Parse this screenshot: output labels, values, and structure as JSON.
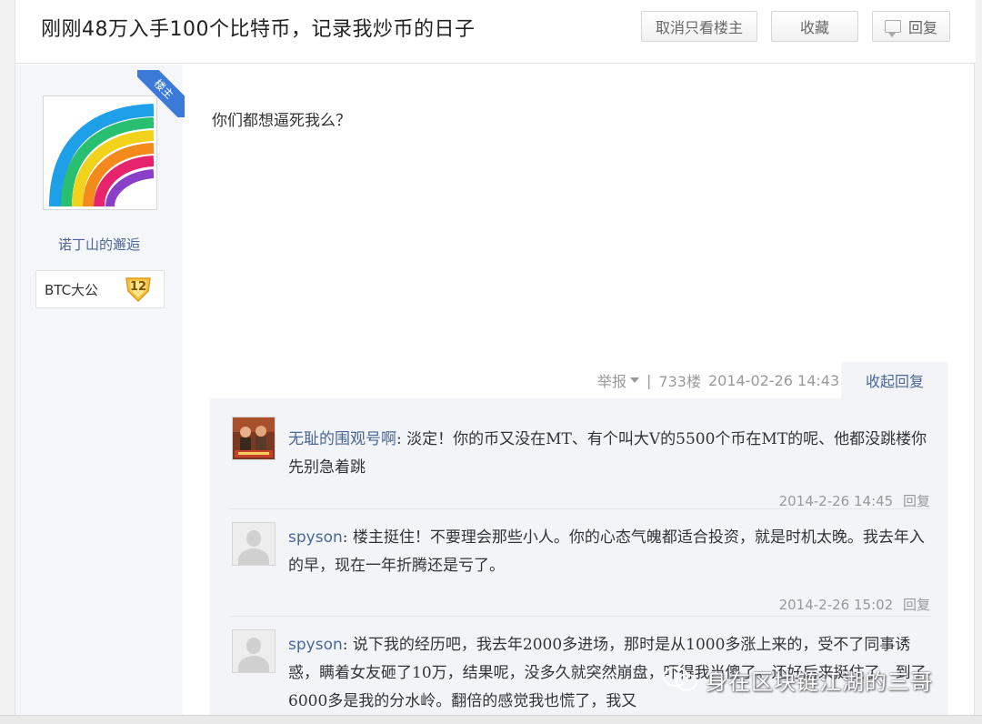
{
  "header": {
    "title": "刚刚48万入手100个比特币，记录我炒币的日子",
    "cancel_only_op_label": "取消只看楼主",
    "favorite_label": "收藏",
    "reply_label": "回复"
  },
  "author": {
    "op_badge": "楼主",
    "username": "诺丁山的邂逅",
    "rank_name": "BTC大公",
    "level": "12"
  },
  "post": {
    "content": "你们都想逼死我么？",
    "report_label": "举报",
    "separator": "|",
    "floor": "733楼",
    "time": "2014-02-26 14:43",
    "collapse_label": "收起回复"
  },
  "replies": [
    {
      "user": "无耻的围观号啊",
      "text": ": 淡定！你的币又没在MT、有个叫大V的5500个币在MT的呢、他都没跳楼你先别急着跳",
      "time": "2014-2-26 14:45",
      "reply_label": "回复"
    },
    {
      "user": "spyson",
      "text": ": 楼主挺住！不要理会那些小人。你的心态气魄都适合投资，就是时机太晚。我去年入的早，现在一年折腾还是亏了。",
      "time": "2014-2-26 15:02",
      "reply_label": "回复"
    },
    {
      "user": "spyson",
      "text": ": 说下我的经历吧，我去年2000多进场，那时是从1000多涨上来的，受不了同事诱惑，瞒着女友砸了10万，结果呢，没多久就突然崩盘，吓得我当傻了。还好后来挺住了，到了6000多是我的分水岭。翻倍的感觉我也慌了，我又"
    }
  ],
  "watermark": {
    "text": "身在区块链江湖的三哥",
    "icon": "wechat-icon"
  },
  "colors": {
    "link_blue": "#4a6796",
    "badge_blue": "#3b7ad8",
    "reply_bg": "#f2f4f8",
    "sidebar_bg": "#f4f6f9"
  }
}
